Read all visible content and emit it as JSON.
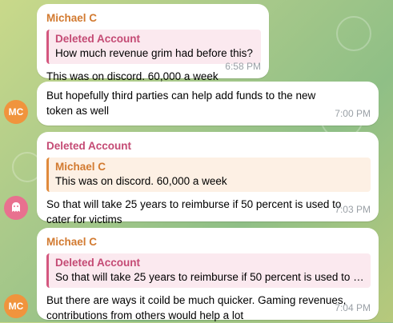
{
  "messages": [
    {
      "sender": "Michael C",
      "quote_name": "Deleted Account",
      "quote_text": "How much revenue grim had before this?",
      "text": "This was on discord. 60,000 a week",
      "time": "6:58 PM"
    },
    {
      "text": "But hopefully third parties can help add funds to the new token as well",
      "time": "7:00 PM",
      "avatar": "MC"
    },
    {
      "sender": "Deleted Account",
      "quote_name": "Michael C",
      "quote_text": "This was on discord. 60,000 a week",
      "text": "So that will take 25 years to reimburse if 50 percent is used to cater for victims",
      "time": "7:03 PM",
      "avatar_icon": "ghost-icon"
    },
    {
      "sender": "Michael C",
      "quote_name": "Deleted Account",
      "quote_text": "So that will take 25 years to reimburse if 50 percent is used to …",
      "text": "But there are ways it coild be much quicker. Gaming revenues, contributions from others would help a lot",
      "time": "7:04 PM",
      "avatar": "MC"
    }
  ],
  "colors": {
    "pink_name": "#c44a74",
    "orange_name": "#d27a30",
    "avatar_mc": "#f0943d",
    "avatar_ghost": "#e8718f"
  }
}
